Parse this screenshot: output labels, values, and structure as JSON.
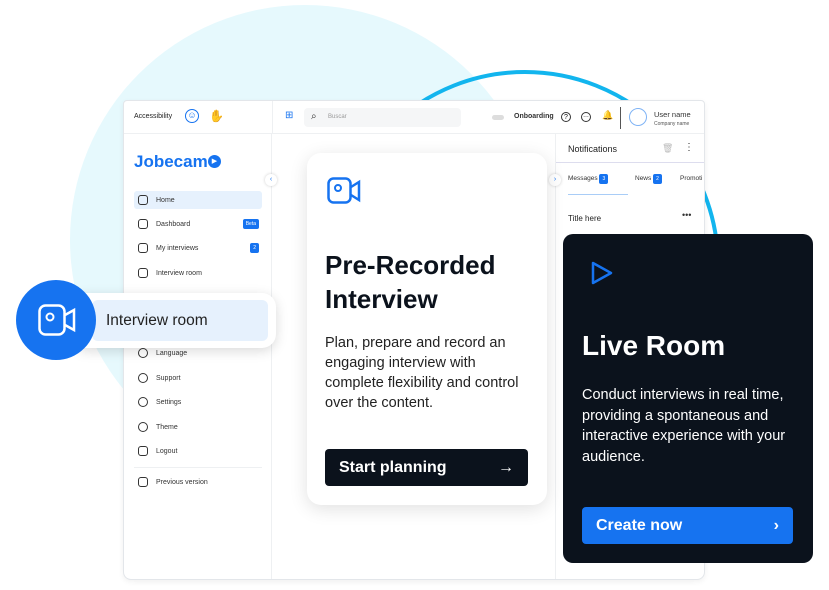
{
  "topbar": {
    "accessibility": "Accessibility",
    "search_placeholder": "Buscar",
    "onboarding": "Onboarding",
    "user_name": "User name",
    "company_name": "Company name"
  },
  "sidebar": {
    "logo": "Jobecam",
    "items": [
      {
        "label": "Home"
      },
      {
        "label": "Dashboard",
        "badge": "Beta"
      },
      {
        "label": "My interviews",
        "badge": "2"
      },
      {
        "label": "Interview room"
      },
      {
        "label": "Language"
      },
      {
        "label": "Support"
      },
      {
        "label": "Settings"
      },
      {
        "label": "Theme"
      },
      {
        "label": "Logout"
      }
    ],
    "previous_version": "Previous version"
  },
  "popup": {
    "label": "Interview room"
  },
  "notifications": {
    "title": "Notifications",
    "tabs": [
      {
        "label": "Messages",
        "count": "3"
      },
      {
        "label": "News",
        "count": "2"
      },
      {
        "label": "Promoti"
      }
    ],
    "item_title": "Title here"
  },
  "prerecorded": {
    "title_line1": "Pre-Recorded",
    "title_line2": "Interview",
    "description": "Plan, prepare and record an engaging interview with complete flexibility and control over the content.",
    "button": "Start planning"
  },
  "live": {
    "title": "Live Room",
    "description": "Conduct interviews in real time, providing a spontaneous and interactive experience with your audience.",
    "button": "Create now"
  },
  "colors": {
    "brand": "#1673f0",
    "dark": "#0b121c",
    "accent_cyan": "#12b5ee"
  }
}
